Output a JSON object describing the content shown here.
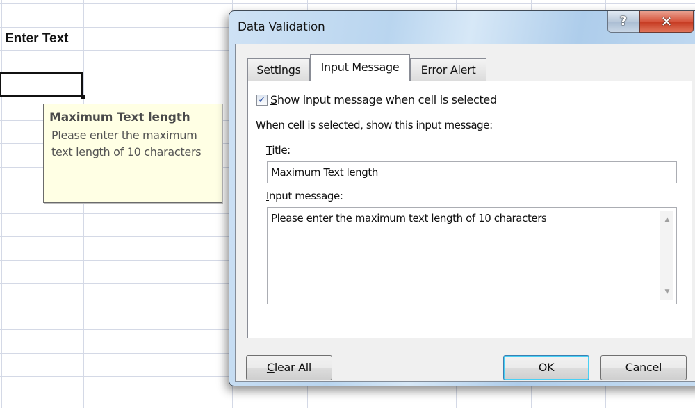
{
  "spreadsheet": {
    "cell_text": "Enter Text",
    "tooltip": {
      "title": "Maximum Text length",
      "message": "Please enter the maximum text length of 10 characters"
    }
  },
  "dialog": {
    "title": "Data Validation",
    "help_icon": "?",
    "close_icon": "✕",
    "tabs": [
      {
        "label": "Settings",
        "active": false
      },
      {
        "label": "Input Message",
        "active": true
      },
      {
        "label": "Error Alert",
        "active": false
      }
    ],
    "show_message_checkbox": {
      "checked": true,
      "label_accesskey": "S",
      "label_rest": "how input message when cell is selected"
    },
    "group_label": "When cell is selected, show this input message:",
    "title_field": {
      "label_accesskey": "T",
      "label_rest": "itle:",
      "value": "Maximum Text length"
    },
    "message_field": {
      "label_accesskey": "I",
      "label_rest": "nput message:",
      "value": "Please enter the maximum text length of 10 characters"
    },
    "buttons": {
      "clear_all_accesskey": "C",
      "clear_all_rest": "lear All",
      "ok": "OK",
      "cancel": "Cancel"
    }
  }
}
